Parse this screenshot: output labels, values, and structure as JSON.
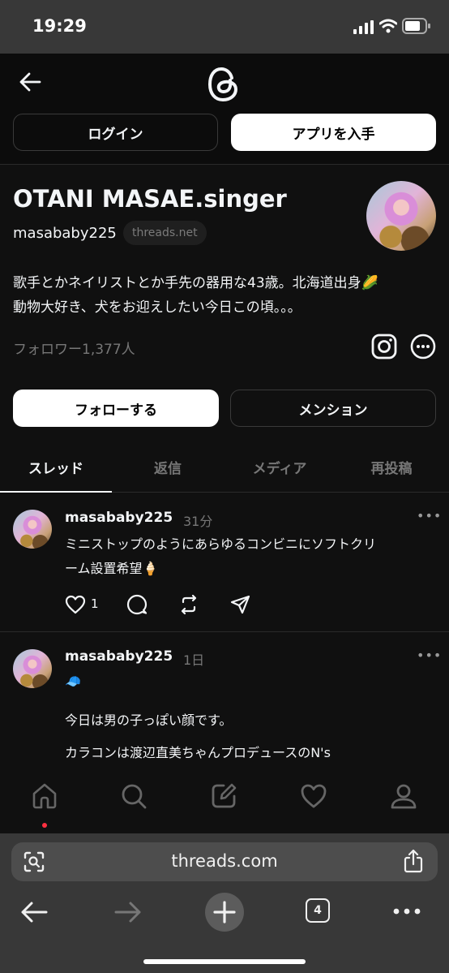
{
  "status_bar": {
    "time": "19:29"
  },
  "header": {
    "login_label": "ログイン",
    "get_app_label": "アプリを入手"
  },
  "profile": {
    "name": "OTANI MASAE.singer",
    "username": "masababy225",
    "domain_badge": "threads.net",
    "bio_line1": "歌手とかネイリストとか手先の器用な43歳。北海道出身🌽",
    "bio_line2": "動物大好き、犬をお迎えしたい今日この頃。。。",
    "followers": "フォロワー1,377人",
    "follow_label": "フォローする",
    "mention_label": "メンション"
  },
  "tabs": [
    {
      "label": "スレッド",
      "active": true
    },
    {
      "label": "返信",
      "active": false
    },
    {
      "label": "メディア",
      "active": false
    },
    {
      "label": "再投稿",
      "active": false
    }
  ],
  "posts": [
    {
      "username": "masababy225",
      "time": "31分",
      "lines": [
        "ミニストップのようにあらゆるコンビニにソフトクリ",
        "ーム設置希望🍦"
      ],
      "like_count": "1"
    },
    {
      "username": "masababy225",
      "time": "1日",
      "emoji": "🧢",
      "line1": "今日は男の子っぽい顔です。",
      "line2": "カラコンは渡辺直美ちゃんプロデュースのN's"
    }
  ],
  "browser": {
    "url": "threads.com",
    "tab_count": "4"
  },
  "colors": {
    "accent_dot": "#ff3040",
    "background": "#101010"
  }
}
